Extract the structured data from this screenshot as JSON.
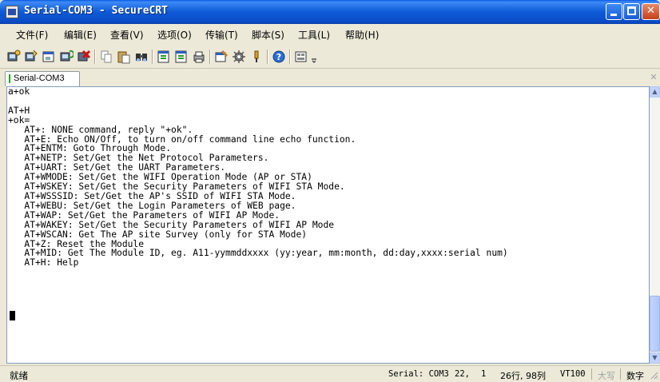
{
  "window": {
    "title": "Serial-COM3 - SecureCRT",
    "min_glyph": "_",
    "max_glyph": "□",
    "close_glyph": "✕"
  },
  "menu": [
    {
      "label": "文件(F)",
      "name": "menu-file"
    },
    {
      "label": "编辑(E)",
      "name": "menu-edit"
    },
    {
      "label": "查看(V)",
      "name": "menu-view"
    },
    {
      "label": "选项(O)",
      "name": "menu-options"
    },
    {
      "label": "传输(T)",
      "name": "menu-transfer"
    },
    {
      "label": "脚本(S)",
      "name": "menu-script"
    },
    {
      "label": "工具(L)",
      "name": "menu-tools"
    },
    {
      "label": "帮助(H)",
      "name": "menu-help"
    }
  ],
  "toolbar": {
    "icons": [
      "connect-icon",
      "quick-connect-icon",
      "connect-tab-icon",
      "reconnect-icon",
      "disconnect-icon",
      "copy-icon",
      "paste-icon",
      "find-icon",
      "print-icon",
      "print-selection-icon",
      "printer-icon",
      "session-options-icon",
      "global-options-icon",
      "keymap-icon",
      "help-icon",
      "sftp-icon",
      "more-icon"
    ]
  },
  "tabs": [
    {
      "label": "Serial-COM3",
      "active": true
    }
  ],
  "terminal": {
    "lines": [
      "a+ok",
      "",
      "AT+H",
      "+ok=",
      "   AT+: NONE command, reply \"+ok\".",
      "   AT+E: Echo ON/Off, to turn on/off command line echo function.",
      "   AT+ENTM: Goto Through Mode.",
      "   AT+NETP: Set/Get the Net Protocol Parameters.",
      "   AT+UART: Set/Get the UART Parameters.",
      "   AT+WMODE: Set/Get the WIFI Operation Mode (AP or STA)",
      "   AT+WSKEY: Set/Get the Security Parameters of WIFI STA Mode.",
      "   AT+WSSSID: Set/Get the AP's SSID of WIFI STA Mode.",
      "   AT+WEBU: Set/Get the Login Parameters of WEB page.",
      "   AT+WAP: Set/Get the Parameters of WIFI AP Mode.",
      "   AT+WAKEY: Set/Get the Security Parameters of WIFI AP Mode",
      "   AT+WSCAN: Get The AP site Survey (only for STA Mode)",
      "   AT+Z: Reset the Module",
      "   AT+MID: Get The Module ID, eg. A11-yymmddxxxx (yy:year, mm:month, dd:day,xxxx:serial num)",
      "   AT+H: Help"
    ]
  },
  "status": {
    "ready": "就绪",
    "connection": "Serial: COM3",
    "row": "22,",
    "col": "1",
    "size": "26行, 98列",
    "emulation": "VT100",
    "caps": "大写",
    "num": "数字"
  },
  "colors": {
    "titlebar": "#0a5ae4",
    "terminal_bg": "#ffffff",
    "tab_indicator": "#19a819"
  }
}
